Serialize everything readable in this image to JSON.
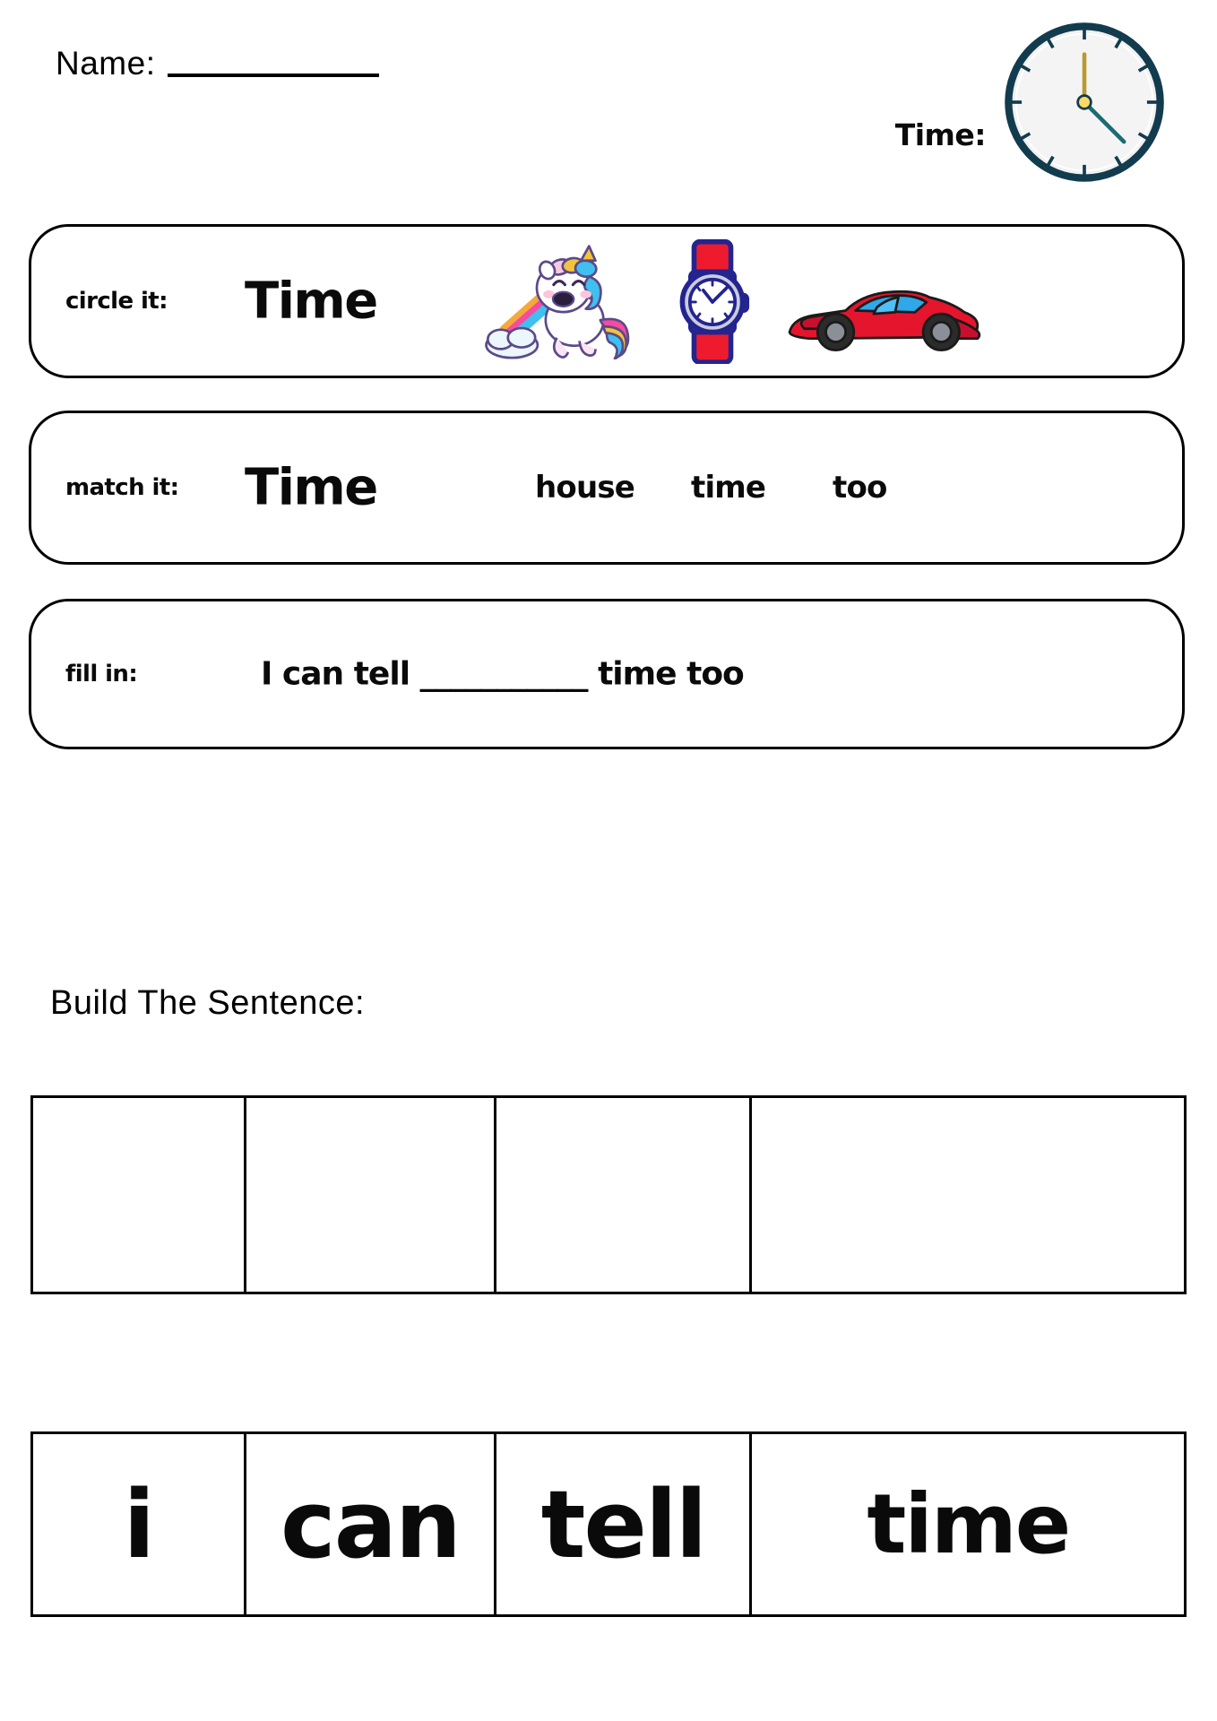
{
  "page": {
    "title": "Sight Word Worksheet - Time",
    "background": "#ffffff"
  },
  "header": {
    "name_label": "Name:",
    "name_value": "",
    "time_label": "Time:",
    "clock": {
      "icon": "analog-clock-icon",
      "rim_color": "#123c4e",
      "face_color": "#f1f1f1",
      "hour_hand_color": "#c4a53a",
      "minute_hand_color": "#1c6b72",
      "center_color": "#ffd966",
      "hour_hand_angle_deg": 0,
      "minute_hand_angle_deg": 140,
      "tick_count": 12
    }
  },
  "activities": [
    {
      "id": "circle-it",
      "tag": "circle it:",
      "word": "Time",
      "pictures": [
        {
          "name": "unicorn-rainbow-icon",
          "alt": "unicorn with rainbow"
        },
        {
          "name": "wristwatch-icon",
          "alt": "red wristwatch"
        },
        {
          "name": "sports-car-icon",
          "alt": "red sports car"
        }
      ]
    },
    {
      "id": "match-it",
      "tag": "match it:",
      "word": "Time",
      "choices": [
        "house",
        "time",
        "too"
      ]
    },
    {
      "id": "fill-in",
      "tag": "fill in:",
      "sentence": "I can tell ___________ time too"
    }
  ],
  "build": {
    "heading": "Build The Sentence:",
    "cell_count": 4,
    "cells": [
      "",
      "",
      "",
      ""
    ]
  },
  "word_tiles": {
    "words": [
      "i",
      "can",
      "tell",
      "time"
    ],
    "widths": [
      "18.5%",
      "21.8%",
      "22.2%",
      "18.7%"
    ]
  },
  "colors": {
    "ink": "#000000",
    "paper": "#ffffff",
    "clock_rim": "#123c4e",
    "clock_face": "#f1f1f1",
    "clock_center": "#ffd966",
    "watch_strap": "#e8192c",
    "watch_case": "#2b2b8f",
    "car_body": "#e5152e",
    "car_glass": "#2ea8e8"
  }
}
